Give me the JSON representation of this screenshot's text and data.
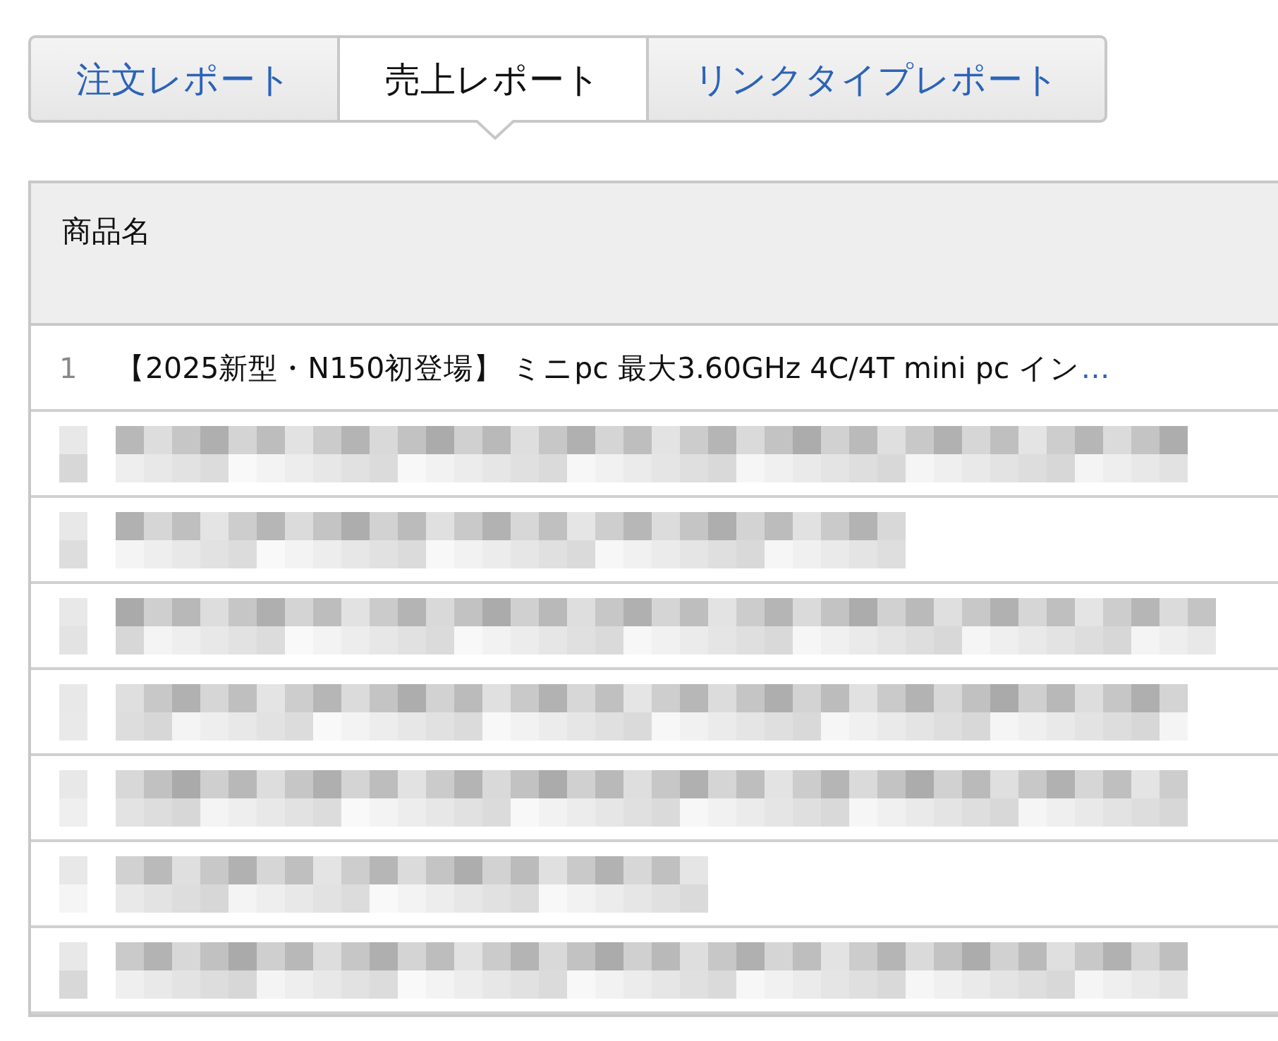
{
  "tabs": [
    {
      "label": "注文レポート",
      "selected": false
    },
    {
      "label": "売上レポート",
      "selected": true
    },
    {
      "label": "リンクタイプレポート",
      "selected": false
    }
  ],
  "table": {
    "columns": [
      "商品名"
    ],
    "rows": [
      {
        "kind": "item",
        "number": "1",
        "title": "【2025新型・N150初登場】 ミニpc 最大3.60GHz 4C/4T mini pc イン",
        "more": "…"
      },
      {
        "kind": "redacted"
      },
      {
        "kind": "redacted"
      },
      {
        "kind": "redacted"
      },
      {
        "kind": "redacted"
      },
      {
        "kind": "redacted"
      },
      {
        "kind": "redacted"
      },
      {
        "kind": "redacted"
      }
    ]
  }
}
